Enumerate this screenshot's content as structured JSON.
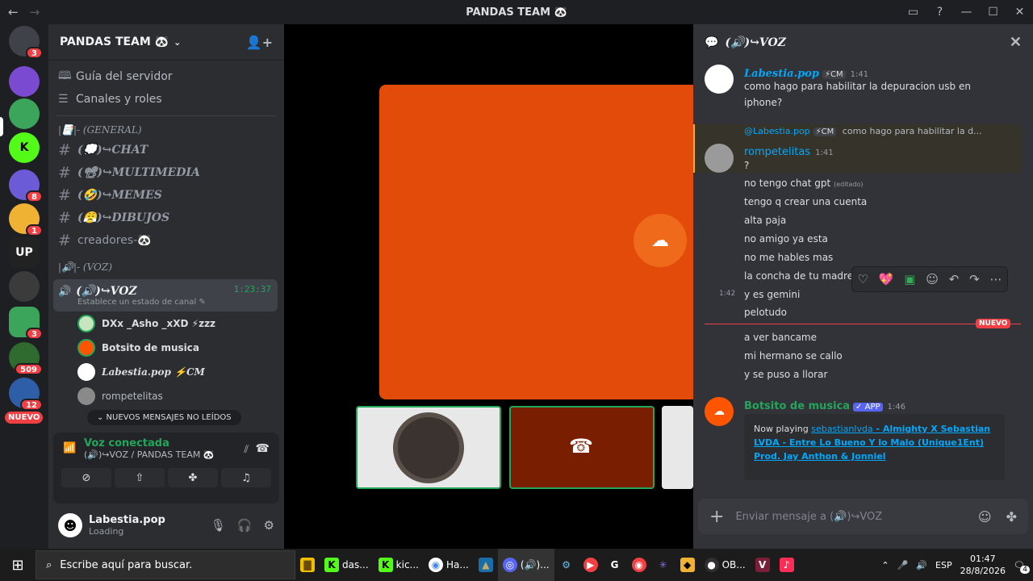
{
  "window": {
    "title": "PANDAS TEAM 🐼",
    "back": "←",
    "forward": "→"
  },
  "servers": [
    {
      "badge": "3",
      "color": "#5865f2"
    },
    {
      "badge": "",
      "color": "#7a4bd1"
    },
    {
      "badge": "",
      "color": "#3ba55c"
    },
    {
      "badge": "",
      "color": "#53fc18"
    },
    {
      "badge": "8",
      "color": "#6b5bd6"
    },
    {
      "badge": "1",
      "color": "#f0b232"
    },
    {
      "badge": "",
      "color": "#222222"
    },
    {
      "badge": "",
      "color": "#3b3b3b"
    },
    {
      "badge": "3",
      "color": "#3ba55c"
    },
    {
      "badge": "509",
      "color": "#2f6b2f"
    },
    {
      "badge": "12",
      "color": "#2e5ea8"
    }
  ],
  "rail_nuevo": "NUEVO",
  "guild": {
    "name": "PANDAS TEAM 🐼"
  },
  "nav": [
    {
      "icon": "🕮",
      "label": "Guía del servidor"
    },
    {
      "icon": "☰",
      "label": "Canales y roles"
    }
  ],
  "categories": {
    "general": "|📑|- (GENERAL)",
    "voz": "|🔊|- (VOZ)"
  },
  "channels": [
    {
      "label": "(💭)↪CHAT"
    },
    {
      "label": "(📽)↪MULTIMEDIA"
    },
    {
      "label": "(🤣)↪MEMES"
    },
    {
      "label": "(😤)↪DIBUJOS"
    },
    {
      "label": "creadores-🐼"
    }
  ],
  "voice_channel": {
    "name": "(🔊)↪VOZ",
    "timer": "1:23:37",
    "status": "Establece un estado de canal ✎"
  },
  "voice_users": [
    {
      "name": "DXx _Asho _xXD ⚡zzz",
      "color": "#c7e6c0"
    },
    {
      "name": "Botsito de musica",
      "color": "#ff5500"
    },
    {
      "name": "Labestia.pop ⚡CM",
      "color": "#ffffff"
    },
    {
      "name": "rompetelitas",
      "color": "#8a8a8a"
    }
  ],
  "unread_pill": "⌄ NUEVOS MENSAJES NO LEÍDOS",
  "voice_connected": {
    "label": "Voz conectada",
    "sub": "(🔊)↪VOZ / PANDAS TEAM 🐼"
  },
  "user": {
    "name": "Labestia.pop",
    "status": "Loading"
  },
  "panel": {
    "title": "(🔊)↪VOZ"
  },
  "msg1": {
    "author": "Labestia.pop",
    "tag": "⚡CM",
    "time": "1:41",
    "text1": "como hago para habilitar la depuracion usb en",
    "text2": "iphone?"
  },
  "reply": {
    "ref_author": "@Labestia.pop",
    "ref_tag": "⚡CM",
    "ref_text": "como hago para habilitar la d...",
    "author": "rompetelitas",
    "time": "1:41"
  },
  "lines": [
    "?",
    "no tengo chat gpt",
    "tengo q crear una cuenta",
    "alta paja",
    "no amigo ya esta",
    "no me hables mas",
    "la concha de tu madre",
    "y es gemini",
    "pelotudo",
    "a ver bancame",
    "mi hermano se callo",
    "y se puso a llorar"
  ],
  "edited": "(editado)",
  "hover_time": "1:42",
  "new_label": "NUEVO",
  "bot": {
    "author": "Botsito de musica",
    "tag": "✓ APP",
    "time": "1:46",
    "now_playing": "Now playing",
    "link_user": "sebastianlvda",
    "link_title": " - Almighty X Sebastian LVDA - Entre Lo Bueno Y lo Malo (Unique1Ent) Prod. Jay Anthon & Jonniel"
  },
  "composer": {
    "placeholder": "Enviar mensaje a (🔊)↪VOZ"
  },
  "taskbar": {
    "search": "Escribe aquí para buscar.",
    "apps": [
      {
        "label": "",
        "icon": "▇",
        "color": "#f0c000"
      },
      {
        "label": "das...",
        "icon": "K",
        "color": "#53fc18"
      },
      {
        "label": "kic...",
        "icon": "K",
        "color": "#53fc18"
      },
      {
        "label": "Ha...",
        "icon": "◉",
        "color": "#4285f4"
      },
      {
        "label": "",
        "icon": "▲",
        "color": "#1a6ea8"
      },
      {
        "label": "(🔊)...",
        "icon": "◎",
        "color": "#5865f2"
      },
      {
        "label": "",
        "icon": "⚙",
        "color": "#1b2838"
      },
      {
        "label": "OB...",
        "icon": "●",
        "color": "#302e31"
      }
    ],
    "lang": "ESP",
    "time": "01:47",
    "date": "28/8/2026",
    "notif": "4"
  }
}
